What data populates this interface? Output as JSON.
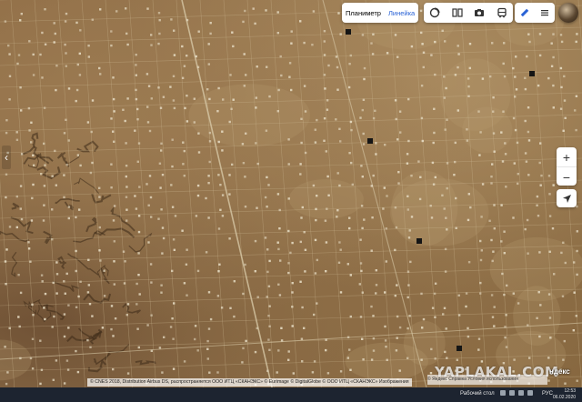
{
  "toolbar": {
    "measure": {
      "planimeter": "Планиметр",
      "ruler": "Линейка"
    }
  },
  "icons": {
    "panorama": "panorama-icon",
    "street": "street-view-icon",
    "photo": "photo-icon",
    "transport": "bus-icon",
    "ruler": "ruler-icon",
    "menu": "hamburger-menu-icon"
  },
  "zoom": {
    "in": "+",
    "out": "−"
  },
  "copyright": "© CNES 2018, Distribution Airbus DS, распространяется ООО ИТЦ «СКАНЭКС» © Eurimage © DigitalGlobe © ООО ИТЦ «СКАНЭКС» Изображения",
  "attribution": "© Яндекс  Справка  Условия использования",
  "logo": "ндекс",
  "watermark": "YAPLAKAL.COM",
  "taskbar": {
    "desktop": "Рабочий стол",
    "lang": "РУС",
    "time": "12:53",
    "date": "06.02.2020"
  },
  "colors": {
    "accent": "#2a63d6",
    "taskbar": "#1d2430"
  }
}
